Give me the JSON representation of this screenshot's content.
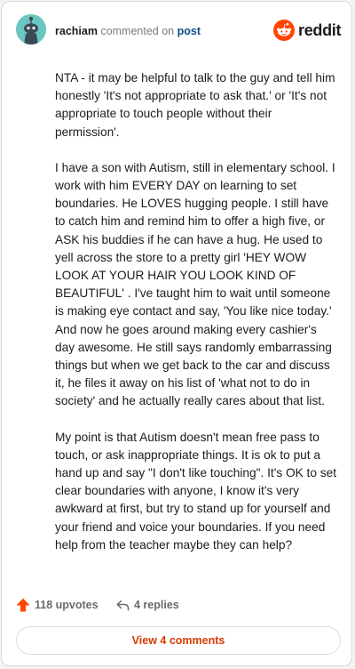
{
  "header": {
    "username": "rachiam",
    "action_text": "commented on",
    "post_link": "post",
    "brand_name": "reddit"
  },
  "comment": {
    "paragraphs": [
      "NTA - it may be helpful to talk to the guy and tell him honestly 'It's not appropriate to ask that.' or 'It's not appropriate to touch people without their permission'.",
      "I have a son with Autism, still in elementary school. I work with him EVERY DAY on learning to set boundaries. He LOVES hugging people. I still have to catch him and remind him to offer a high five, or ASK his buddies if he can have a hug. He used to yell across the store to a pretty girl 'HEY WOW LOOK AT YOUR HAIR YOU LOOK KIND OF BEAUTIFUL' . I've taught him to wait until someone is making eye contact and say, 'You like nice today.' And now he goes around making every cashier's day awesome. He still says randomly embarrassing things but when we get back to the car and discuss it, he files it away on his list of 'what not to do in society' and he actually really cares about that list.",
      "My point is that Autism doesn't mean free pass to touch, or ask inappropriate things. It is ok to put a hand up and say \"I don't like touching\". It's OK to set clear boundaries with anyone, I know it's very awkward at first, but try to stand up for yourself and your friend and voice your boundaries. If you need help from the teacher maybe they can help?"
    ]
  },
  "footer": {
    "upvotes": "118 upvotes",
    "replies": "4 replies",
    "view_comments": "View 4 comments"
  },
  "colors": {
    "accent": "#d93a00",
    "upvote": "#ff4500",
    "avatar_bg": "#6ac6c0",
    "link": "#0f4c8a"
  },
  "icons": {
    "avatar": "snoo-avatar-icon",
    "brand": "reddit-logo-icon",
    "upvote": "upvote-arrow-icon",
    "reply": "reply-arrow-icon"
  }
}
